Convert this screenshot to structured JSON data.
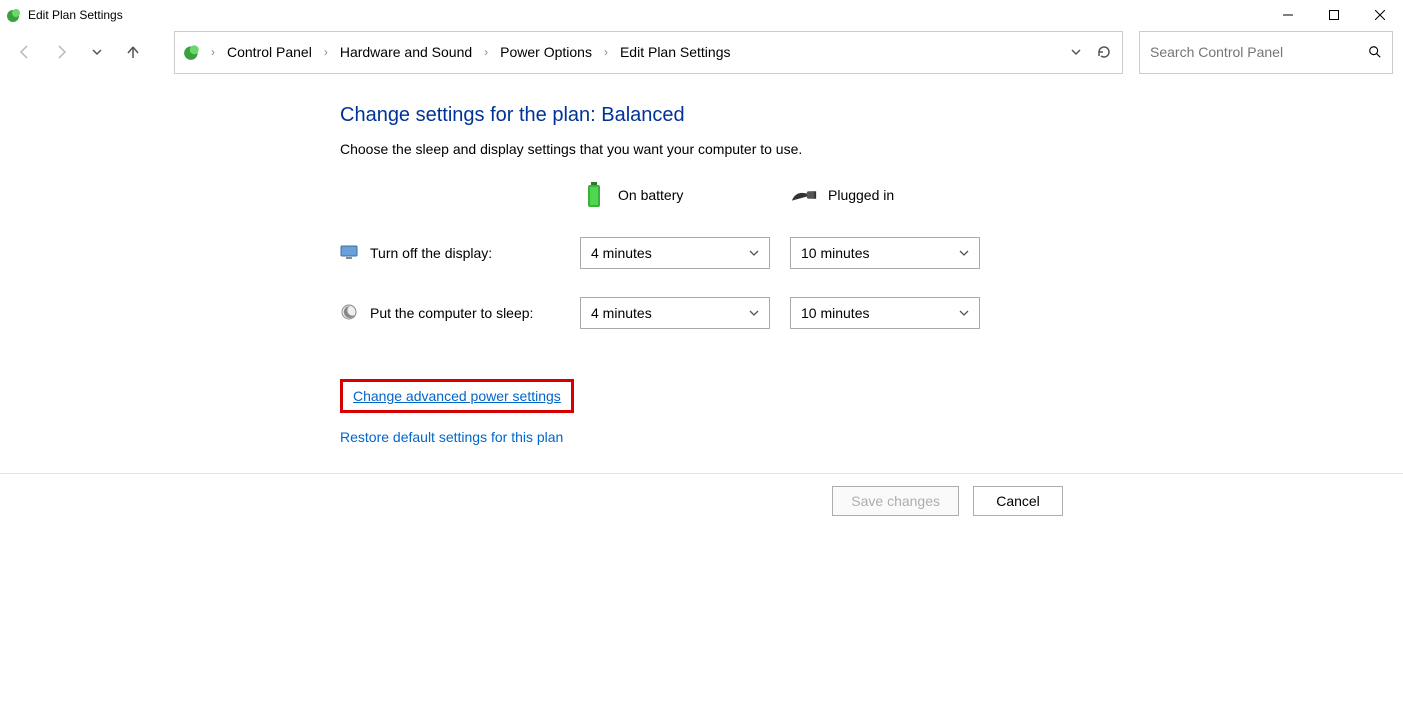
{
  "titlebar": {
    "title": "Edit Plan Settings"
  },
  "breadcrumb": {
    "items": [
      "Control Panel",
      "Hardware and Sound",
      "Power Options",
      "Edit Plan Settings"
    ]
  },
  "search": {
    "placeholder": "Search Control Panel"
  },
  "page": {
    "heading": "Change settings for the plan: Balanced",
    "subtext": "Choose the sleep and display settings that you want your computer to use.",
    "columns": {
      "battery": "On battery",
      "plugged": "Plugged in"
    },
    "rows": {
      "display": {
        "label": "Turn off the display:",
        "battery_value": "4 minutes",
        "plugged_value": "10 minutes"
      },
      "sleep": {
        "label": "Put the computer to sleep:",
        "battery_value": "4 minutes",
        "plugged_value": "10 minutes"
      }
    },
    "links": {
      "advanced": "Change advanced power settings",
      "restore": "Restore default settings for this plan"
    }
  },
  "footer": {
    "save": "Save changes",
    "cancel": "Cancel"
  }
}
